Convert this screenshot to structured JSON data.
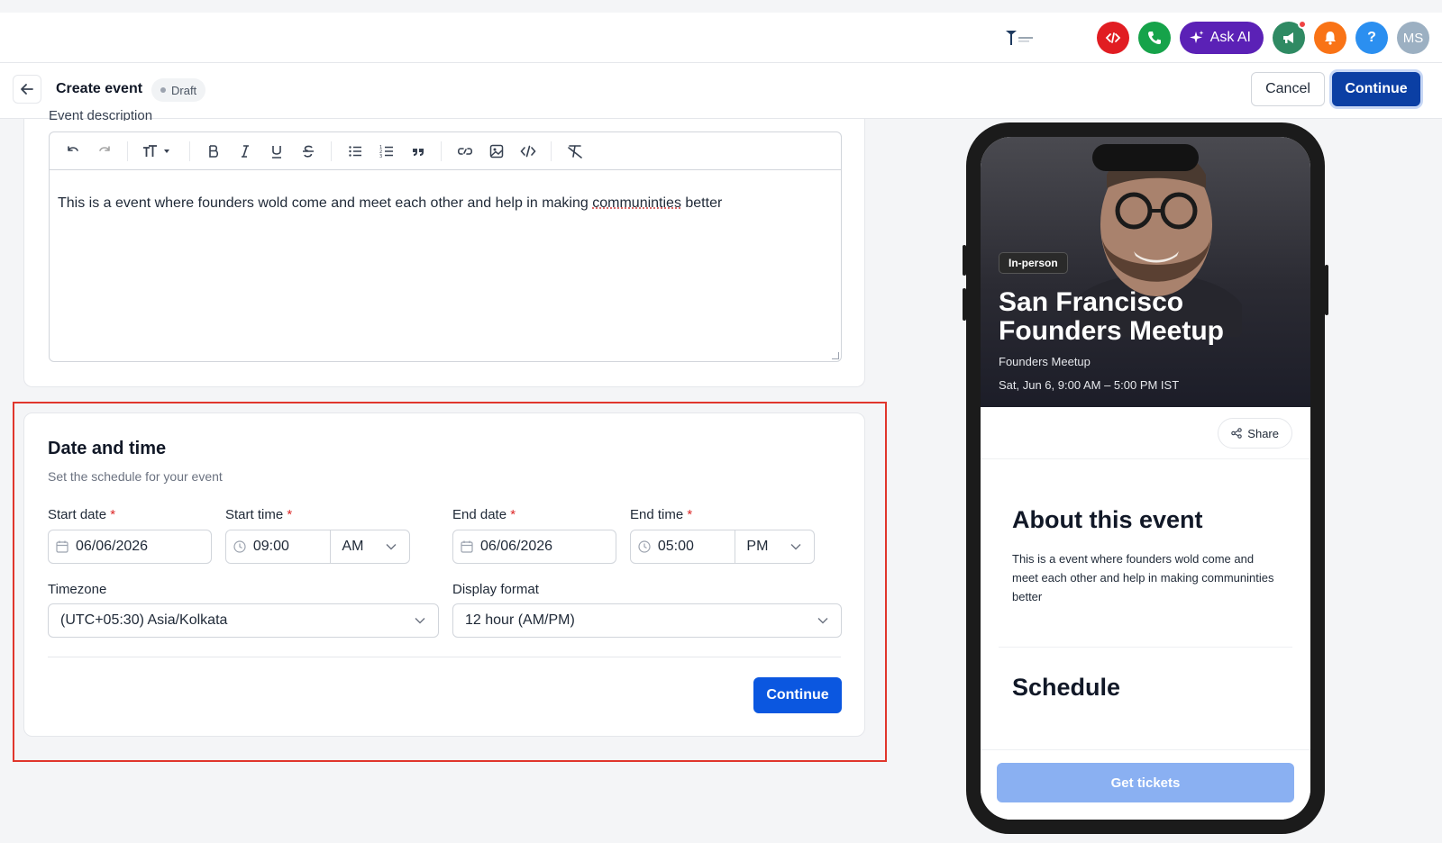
{
  "topbar": {
    "ask_ai_label": "Ask AI",
    "help_label": "?",
    "avatar_initials": "MS"
  },
  "header": {
    "title": "Create event",
    "status_badge": "Draft",
    "cancel_label": "Cancel",
    "continue_label": "Continue"
  },
  "description": {
    "label": "Event description",
    "text_before": "This is a event where founders wold come and meet each other and help in making ",
    "text_misspelled": "communinties",
    "text_after": " better"
  },
  "date_time": {
    "title": "Date and time",
    "subtitle": "Set the schedule for your event",
    "start_date_label": "Start date",
    "start_date_value": "06/06/2026",
    "start_time_label": "Start time",
    "start_time_value": "09:00",
    "start_ampm": "AM",
    "end_date_label": "End date",
    "end_date_value": "06/06/2026",
    "end_time_label": "End time",
    "end_time_value": "05:00",
    "end_ampm": "PM",
    "required_mark": "*",
    "timezone_label": "Timezone",
    "timezone_value": "(UTC+05:30) Asia/Kolkata",
    "display_format_label": "Display format",
    "display_format_value": "12 hour (AM/PM)",
    "continue_label": "Continue"
  },
  "preview": {
    "badge": "In-person",
    "title": "San Francisco Founders Meetup",
    "organizer": "Founders Meetup",
    "datetime": "Sat, Jun 6, 9:00 AM – 5:00 PM IST",
    "share_label": "Share",
    "about_heading": "About this event",
    "about_text": "This is a event where founders wold come and meet each other and help in making communinties better",
    "schedule_heading": "Schedule",
    "tickets_label": "Get tickets"
  },
  "colors": {
    "primary": "#0b57e0",
    "primary_dark": "#0b3fa4",
    "highlight": "#e0362c",
    "ask_ai": "#5b21b6"
  }
}
